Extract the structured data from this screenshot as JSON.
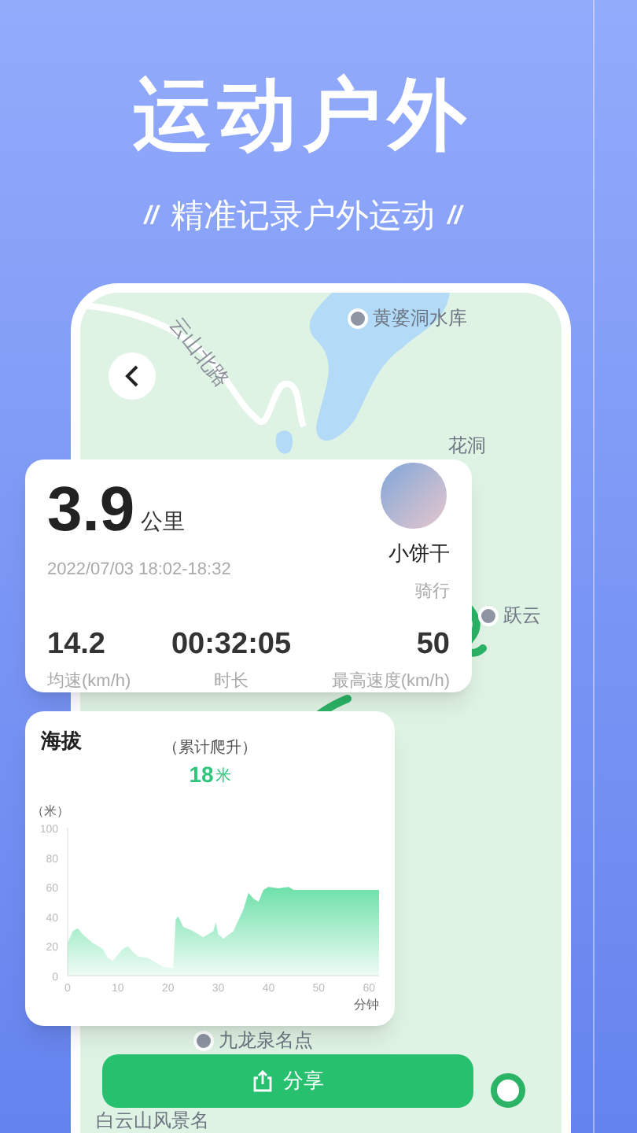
{
  "header": {
    "title": "运动户外",
    "subtitle": "精准记录户外运动",
    "left_mark": "//",
    "right_mark": "//"
  },
  "map": {
    "labels": [
      {
        "text": "云山北路",
        "kind": "road"
      },
      {
        "text": "黄婆洞水库",
        "kind": "poi"
      },
      {
        "text": "花洞",
        "kind": "place"
      },
      {
        "text": "跃云",
        "kind": "poi"
      },
      {
        "text": "九龙泉名点",
        "kind": "poi"
      },
      {
        "text": "白云山风景名",
        "kind": "place"
      }
    ]
  },
  "stats": {
    "distance": "3.9",
    "unit": "公里",
    "datetime": "2022/07/03 18:02-18:32",
    "user_name": "小饼干",
    "activity": "骑行",
    "metrics": [
      {
        "value": "14.2",
        "label": "均速(km/h)"
      },
      {
        "value": "00:32:05",
        "label": "时长"
      },
      {
        "value": "50",
        "label": "最高速度(km/h)"
      }
    ]
  },
  "elevation": {
    "title": "海拔",
    "gain_label": "（累计爬升）",
    "gain_value": "18",
    "gain_unit": "米",
    "chart_data": {
      "type": "area",
      "ylabel": "（米）",
      "xlabel": "分钟",
      "x": [
        0,
        1,
        2,
        3,
        5,
        7,
        8,
        9,
        10,
        11,
        12,
        13,
        14,
        16,
        17,
        18,
        19,
        21,
        21.5,
        22,
        23,
        25,
        27,
        29,
        29.5,
        30,
        31,
        33,
        35,
        36,
        37,
        38,
        39,
        40,
        42,
        44,
        45,
        50,
        55,
        60,
        62
      ],
      "series": [
        {
          "color": "#3dd68c",
          "values": [
            22,
            30,
            32,
            28,
            22,
            18,
            12,
            10,
            14,
            18,
            20,
            16,
            13,
            12,
            10,
            8,
            6,
            5,
            38,
            40,
            33,
            30,
            26,
            30,
            36,
            28,
            25,
            30,
            45,
            56,
            52,
            50,
            58,
            60,
            59,
            60,
            58,
            58,
            58,
            58,
            58
          ]
        }
      ],
      "xlim": [
        0,
        62
      ],
      "ylim": [
        0,
        100
      ],
      "xticks": [
        0,
        10,
        20,
        30,
        40,
        50,
        60
      ],
      "yticks": [
        0,
        20,
        40,
        60,
        80,
        100
      ]
    }
  },
  "share_button": {
    "label": "分享"
  }
}
